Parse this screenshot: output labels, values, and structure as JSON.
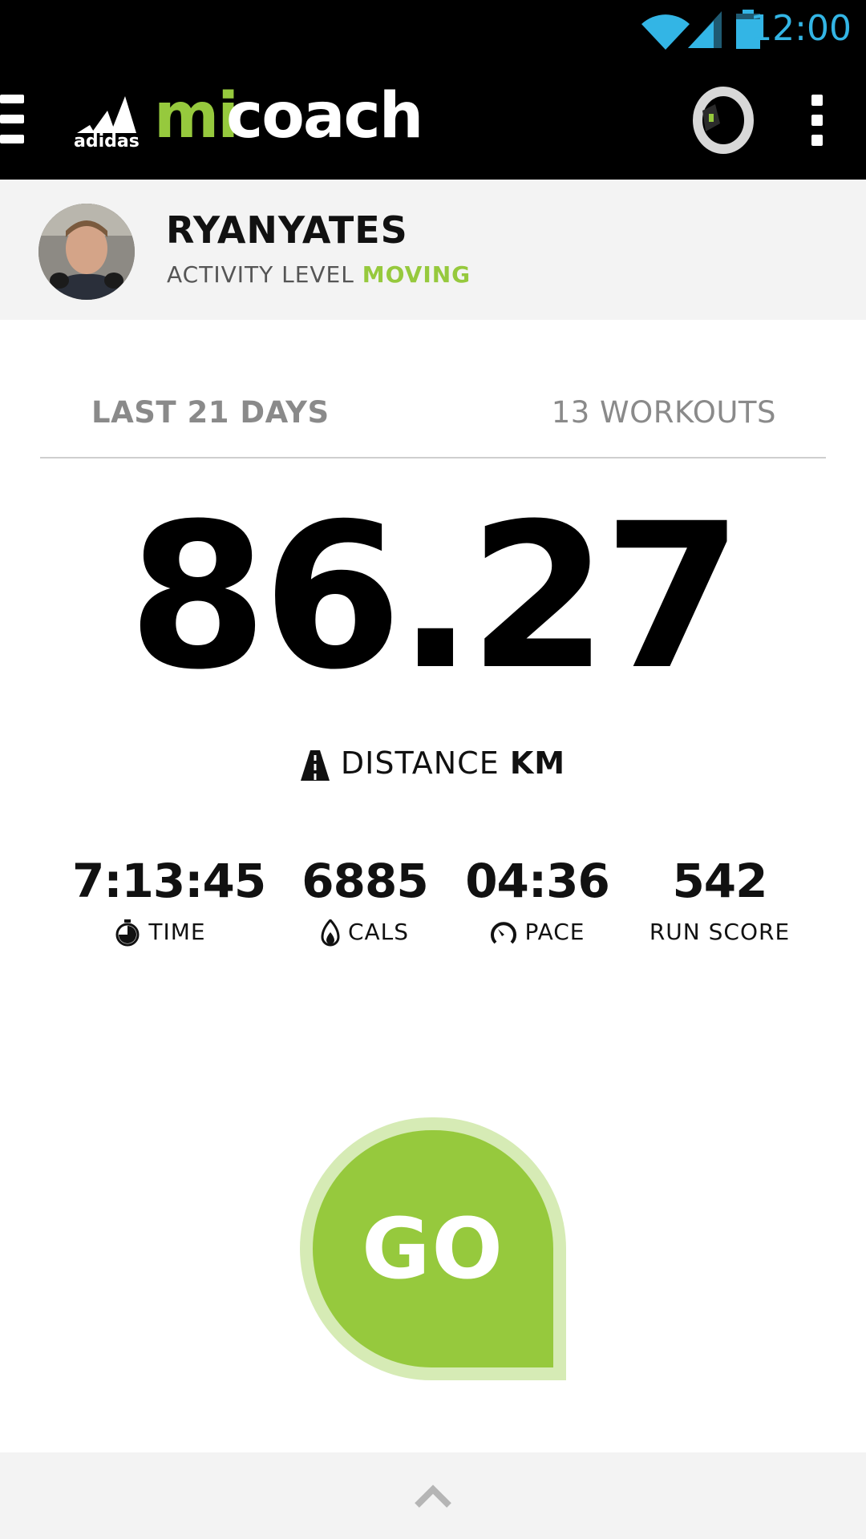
{
  "status_bar": {
    "time": "12:00",
    "icons": [
      "wifi-icon",
      "cell-signal-icon",
      "battery-icon"
    ],
    "accent_color": "#33b5e5"
  },
  "app_bar": {
    "brand_adidas": "adidas",
    "brand_mi": "mi",
    "brand_coach": "coach",
    "brand_color": "#96c93d",
    "icons": [
      "menu-icon",
      "adidas-logo-icon",
      "fit-smart-band-icon",
      "overflow-menu-icon"
    ]
  },
  "profile": {
    "name": "RYANYATES",
    "activity_prefix": "ACTIVITY LEVEL",
    "activity_level": "MOVING"
  },
  "summary": {
    "period": "LAST 21 DAYS",
    "workouts": "13 WORKOUTS",
    "distance_value": "86.27",
    "distance_label": "DISTANCE",
    "distance_unit": "KM"
  },
  "stats": [
    {
      "value": "7:13:45",
      "label": "TIME",
      "icon": "stopwatch-icon"
    },
    {
      "value": "6885",
      "label": "CALS",
      "icon": "flame-icon"
    },
    {
      "value": "04:36",
      "label": "PACE",
      "icon": "pace-gauge-icon"
    },
    {
      "value": "542",
      "label": "RUN SCORE",
      "icon": ""
    }
  ],
  "go_button": {
    "label": "GO",
    "color": "#96c93d",
    "ring_color": "#d6ebb5"
  },
  "bottom_bar": {
    "icon": "chevron-up-icon"
  }
}
